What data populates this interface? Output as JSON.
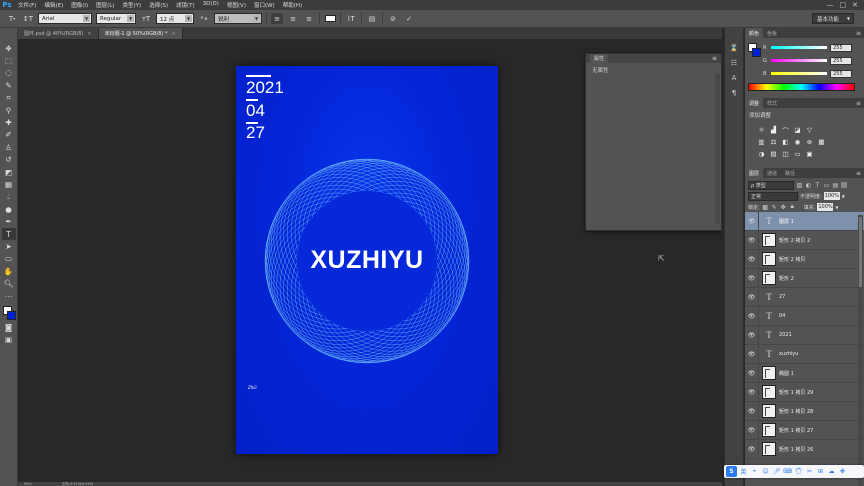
{
  "app": {
    "logo": "Ps"
  },
  "menubar": {
    "items": [
      "文件(F)",
      "编辑(E)",
      "图像(I)",
      "图层(L)",
      "类型(Y)",
      "选择(S)",
      "滤镜(T)",
      "3D(D)",
      "视图(V)",
      "窗口(W)",
      "帮助(H)"
    ],
    "window_buttons": [
      "—",
      "□",
      "✕"
    ]
  },
  "options_bar": {
    "font_family": "Arial",
    "font_style": "Regular",
    "font_size": "12 点",
    "aa_label": "ª a",
    "antialias": "锐利",
    "workspace": "基本功能"
  },
  "tabs": [
    {
      "label": "圆环.psd @ 40%(RGB/8)",
      "active": false
    },
    {
      "label": "未标题-1 @ 50%(RGB/8) *",
      "active": true
    }
  ],
  "poster": {
    "year": "2021",
    "month": "04",
    "day": "27",
    "title": "XUZHIYU",
    "signature": "Zhiii"
  },
  "properties_panel": {
    "tab": "属性",
    "content": "无属性"
  },
  "status": {
    "zoom": "50%",
    "doc": "文档:4.91M/4.91M"
  },
  "color_panel": {
    "tabs": [
      "颜色",
      "色板"
    ],
    "sliders": [
      {
        "label": "R",
        "value": "255",
        "gradient": "linear-gradient(to right,#00ffff,#ffffff)"
      },
      {
        "label": "G",
        "value": "255",
        "gradient": "linear-gradient(to right,#ff00ff,#ffffff)"
      },
      {
        "label": "B",
        "value": "255",
        "gradient": "linear-gradient(to right,#ffff00,#ffffff)"
      }
    ]
  },
  "adjustments_panel": {
    "tabs": [
      "调整",
      "样式"
    ],
    "subtitle": "添加调整"
  },
  "layers_panel": {
    "tabs": [
      "图层",
      "通道",
      "路径"
    ],
    "filter_label": "ρ 类型",
    "blend_mode": "正常",
    "opacity_label": "不透明度:",
    "opacity": "100%",
    "lock_label": "锁定:",
    "fill_label": "填充:",
    "fill": "100%",
    "layers": [
      {
        "name": "图层 1",
        "kind": "text",
        "selected": true
      },
      {
        "name": "矩形 2 拷贝 2",
        "kind": "shape",
        "selected": false
      },
      {
        "name": "矩形 2 拷贝",
        "kind": "shape",
        "selected": false
      },
      {
        "name": "矩形 2",
        "kind": "shape",
        "selected": false
      },
      {
        "name": "27",
        "kind": "text",
        "selected": false
      },
      {
        "name": "04",
        "kind": "text",
        "selected": false
      },
      {
        "name": "2021",
        "kind": "text",
        "selected": false
      },
      {
        "name": "xuzhiyu",
        "kind": "text",
        "selected": false
      },
      {
        "name": "椭圆 1",
        "kind": "shape",
        "selected": false
      },
      {
        "name": "矩形 1 拷贝 29",
        "kind": "shape",
        "selected": false
      },
      {
        "name": "矩形 1 拷贝 28",
        "kind": "shape",
        "selected": false
      },
      {
        "name": "矩形 1 拷贝 27",
        "kind": "shape",
        "selected": false
      },
      {
        "name": "矩形 1 拷贝 26",
        "kind": "shape",
        "selected": false
      }
    ]
  },
  "ime": {
    "logo": "S",
    "mode": "英"
  },
  "colors": {
    "poster_blue": "#0426d8",
    "selection": "#7d91ad",
    "ring": "#7fd3ff"
  }
}
